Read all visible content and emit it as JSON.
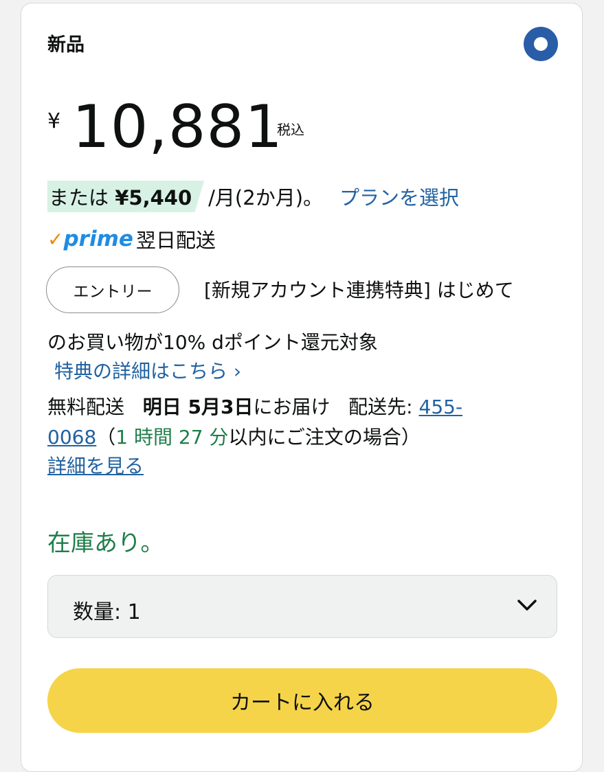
{
  "condition": {
    "label": "新品"
  },
  "price": {
    "currency": "¥",
    "amount": "10,881",
    "tax_label": "税込"
  },
  "installment": {
    "prefix": "または",
    "amount": "¥5,440",
    "suffix": "/月(2か月)。",
    "plan_link": "プランを選択"
  },
  "prime": {
    "check": "✓",
    "word": "prime",
    "delivery": "翌日配送"
  },
  "promo": {
    "entry_button": "エントリー",
    "line1": "[新規アカウント連携特典] はじめて",
    "line2": "のお買い物が10% dポイント還元対象",
    "link": "特典の詳細はこちら ›"
  },
  "delivery": {
    "free_shipping": "無料配送",
    "date": "明日 5月3日",
    "deliver_suffix": "にお届け",
    "ship_to_label": "配送先:",
    "postal_code_part1": "455-",
    "postal_code_part2": "0068",
    "open_paren": "（",
    "countdown": "1 時間 27 分",
    "order_suffix": "以内にご注文の場合）",
    "details_link": "詳細を見る"
  },
  "stock": {
    "status": "在庫あり。"
  },
  "quantity": {
    "label": "数量:",
    "value": "1",
    "icon": "chevron-down-icon"
  },
  "cart": {
    "button_label": "カートに入れる"
  },
  "colors": {
    "link": "#2162a1",
    "stock_green": "#1e7d4a",
    "cart_yellow": "#f5d449",
    "radio_blue": "#2a5da8",
    "installment_highlight": "#d7f2e4",
    "prime_orange": "#f08804",
    "prime_blue": "#1f8ce3"
  }
}
